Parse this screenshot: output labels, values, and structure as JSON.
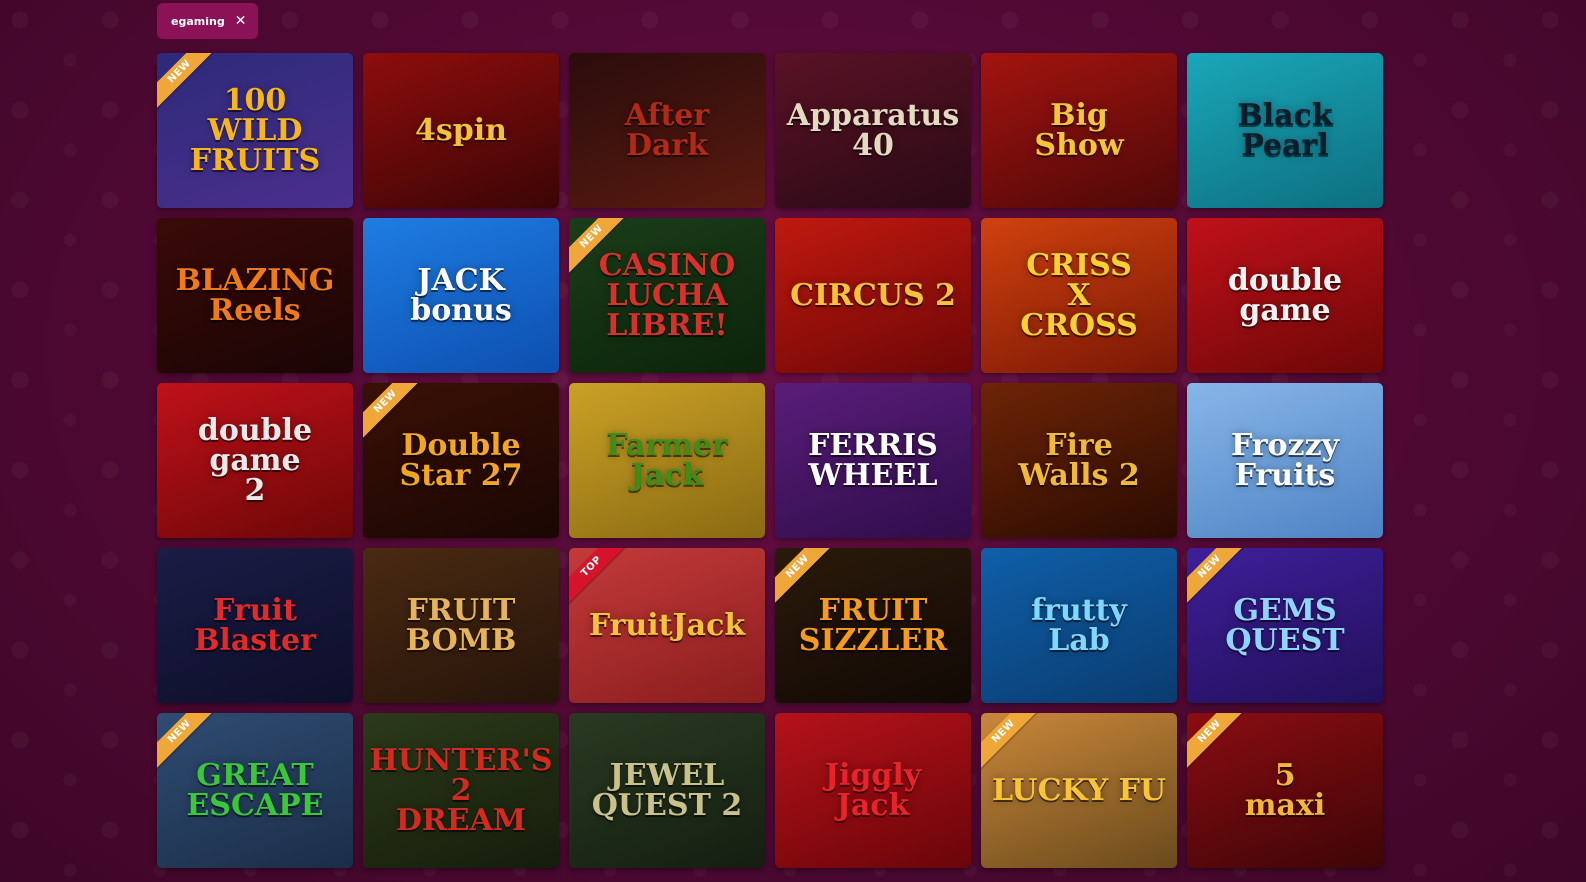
{
  "filter": {
    "label": "egaming",
    "close_icon": "✕"
  },
  "games": [
    {
      "title": "100\nWILD FRUITS",
      "badge": "NEW",
      "bg": "#2d2a7a",
      "bg2": "#4b2f8d",
      "fg": "#f6b51d"
    },
    {
      "title": "4spin",
      "badge": "",
      "bg": "#8e0d0d",
      "bg2": "#3b0505",
      "fg": "#f2c23a"
    },
    {
      "title": "After\nDark",
      "badge": "",
      "bg": "#2a0c0c",
      "bg2": "#5a1b10",
      "fg": "#b02a15"
    },
    {
      "title": "Apparatus\n40",
      "badge": "",
      "bg": "#5a1226",
      "bg2": "#2a0a15",
      "fg": "#e6d9c2"
    },
    {
      "title": "Big\nShow",
      "badge": "",
      "bg": "#a3140f",
      "bg2": "#4e0808",
      "fg": "#f3c53a"
    },
    {
      "title": "Black\nPearl",
      "badge": "",
      "bg": "#1aa7b8",
      "bg2": "#0d6f80",
      "fg": "#0b1d2a"
    },
    {
      "title": "BLAZING\nReels",
      "badge": "",
      "bg": "#3a0a08",
      "bg2": "#1a0505",
      "fg": "#f07a18"
    },
    {
      "title": "JACK\nbonus",
      "badge": "",
      "bg": "#1f7de3",
      "bg2": "#0d4fb0",
      "fg": "#ffffff"
    },
    {
      "title": "CASINO\nLUCHA\nLIBRE!",
      "badge": "NEW",
      "bg": "#1b3d19",
      "bg2": "#0b240b",
      "fg": "#d6312a"
    },
    {
      "title": "CIRCUS 2",
      "badge": "",
      "bg": "#c0190f",
      "bg2": "#6e0707",
      "fg": "#f6c23c"
    },
    {
      "title": "CRISS\nX\nCROSS",
      "badge": "",
      "bg": "#d0420e",
      "bg2": "#7a1706",
      "fg": "#f7d034"
    },
    {
      "title": "double\ngame",
      "badge": "",
      "bg": "#c0111a",
      "bg2": "#6d0707",
      "fg": "#f2f2f2"
    },
    {
      "title": "double\ngame\n2",
      "badge": "",
      "bg": "#c0111a",
      "bg2": "#6d0707",
      "fg": "#e9e9e9"
    },
    {
      "title": "Double Star 27",
      "badge": "NEW",
      "bg": "#3a1005",
      "bg2": "#1a0703",
      "fg": "#f2a623"
    },
    {
      "title": "Farmer\nJack",
      "badge": "",
      "bg": "#caa126",
      "bg2": "#8a6a12",
      "fg": "#3e8d1a"
    },
    {
      "title": "FERRIS\nWHEEL",
      "badge": "",
      "bg": "#5a1d7a",
      "bg2": "#2f0d4a",
      "fg": "#ffffff"
    },
    {
      "title": "Fire\nWalls 2",
      "badge": "",
      "bg": "#6e2406",
      "bg2": "#2a0b02",
      "fg": "#f0b93a"
    },
    {
      "title": "Frozzy\nFruits",
      "badge": "",
      "bg": "#87b6e8",
      "bg2": "#4e82c4",
      "fg": "#ffffff"
    },
    {
      "title": "Fruit\nBlaster",
      "badge": "",
      "bg": "#1a1c45",
      "bg2": "#0e0f2a",
      "fg": "#e22a2a"
    },
    {
      "title": "FRUIT\nBOMB",
      "badge": "",
      "bg": "#4a2a12",
      "bg2": "#26140a",
      "fg": "#e6b35a"
    },
    {
      "title": "FruitJack",
      "badge": "TOP",
      "bg": "#c43a3a",
      "bg2": "#8a1d1d",
      "fg": "#f5c33b"
    },
    {
      "title": "FRUIT\nSIZZLER",
      "badge": "NEW",
      "bg": "#2a1a0a",
      "bg2": "#120905",
      "fg": "#f59a1d"
    },
    {
      "title": "frutty\nLab",
      "badge": "",
      "bg": "#0f5fa8",
      "bg2": "#0a3c70",
      "fg": "#7fd8ff"
    },
    {
      "title": "GEMS\nQUEST",
      "badge": "NEW",
      "bg": "#3e1f9a",
      "bg2": "#22105a",
      "fg": "#8fd3ff"
    },
    {
      "title": "GREAT\nESCAPE",
      "badge": "NEW",
      "bg": "#2f4c73",
      "bg2": "#1b2e48",
      "fg": "#3ac73a"
    },
    {
      "title": "HUNTER'S\n2\nDREAM",
      "badge": "",
      "bg": "#2c3a1a",
      "bg2": "#151d0b",
      "fg": "#d12a1f"
    },
    {
      "title": "JEWEL\nQUEST 2",
      "badge": "",
      "bg": "#2a3a22",
      "bg2": "#151e11",
      "fg": "#c8c28a"
    },
    {
      "title": "Jiggly\nJack",
      "badge": "",
      "bg": "#b5121a",
      "bg2": "#6a0509",
      "fg": "#e8232a"
    },
    {
      "title": "LUCKY FU",
      "badge": "NEW",
      "bg": "#c9873a",
      "bg2": "#6a4a1c",
      "fg": "#f7c43a"
    },
    {
      "title": "5\nmaxi",
      "badge": "NEW",
      "bg": "#8a0d12",
      "bg2": "#3e0507",
      "fg": "#f2b73a"
    }
  ]
}
